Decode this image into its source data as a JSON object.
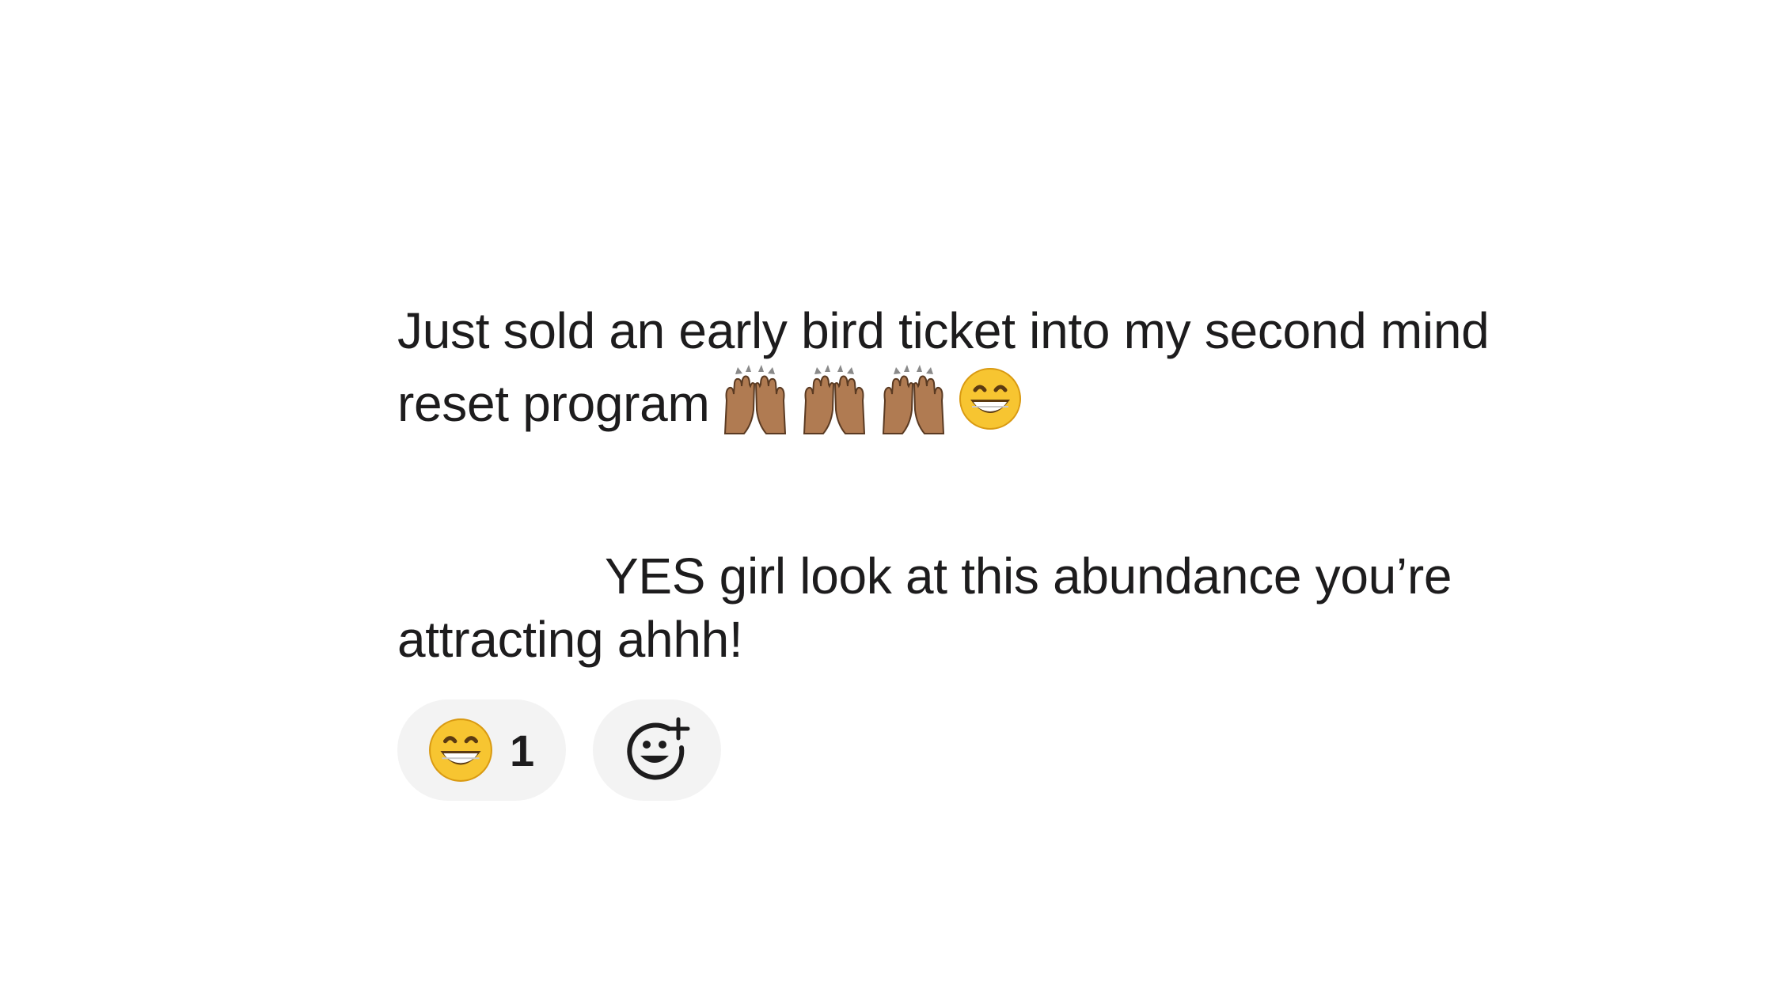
{
  "messages": [
    {
      "text": "Just sold an early bird ticket into my second mind reset program",
      "emojis": [
        "raising-hands-medium-skin-tone",
        "raising-hands-medium-skin-tone",
        "raising-hands-medium-skin-tone",
        "grinning-face-with-smiling-eyes"
      ]
    },
    {
      "text": "YES girl look at this abundance you’re attracting ahhh!",
      "reactions": [
        {
          "emoji": "grinning-face-with-smiling-eyes",
          "count": "1"
        }
      ],
      "add_reaction_icon": "add-reaction-icon"
    }
  ],
  "colors": {
    "text": "#1d1c1d",
    "reaction_bg": "#f3f3f3",
    "emoji_yellow": "#f7c531",
    "skin_tone": "#b07b52"
  }
}
